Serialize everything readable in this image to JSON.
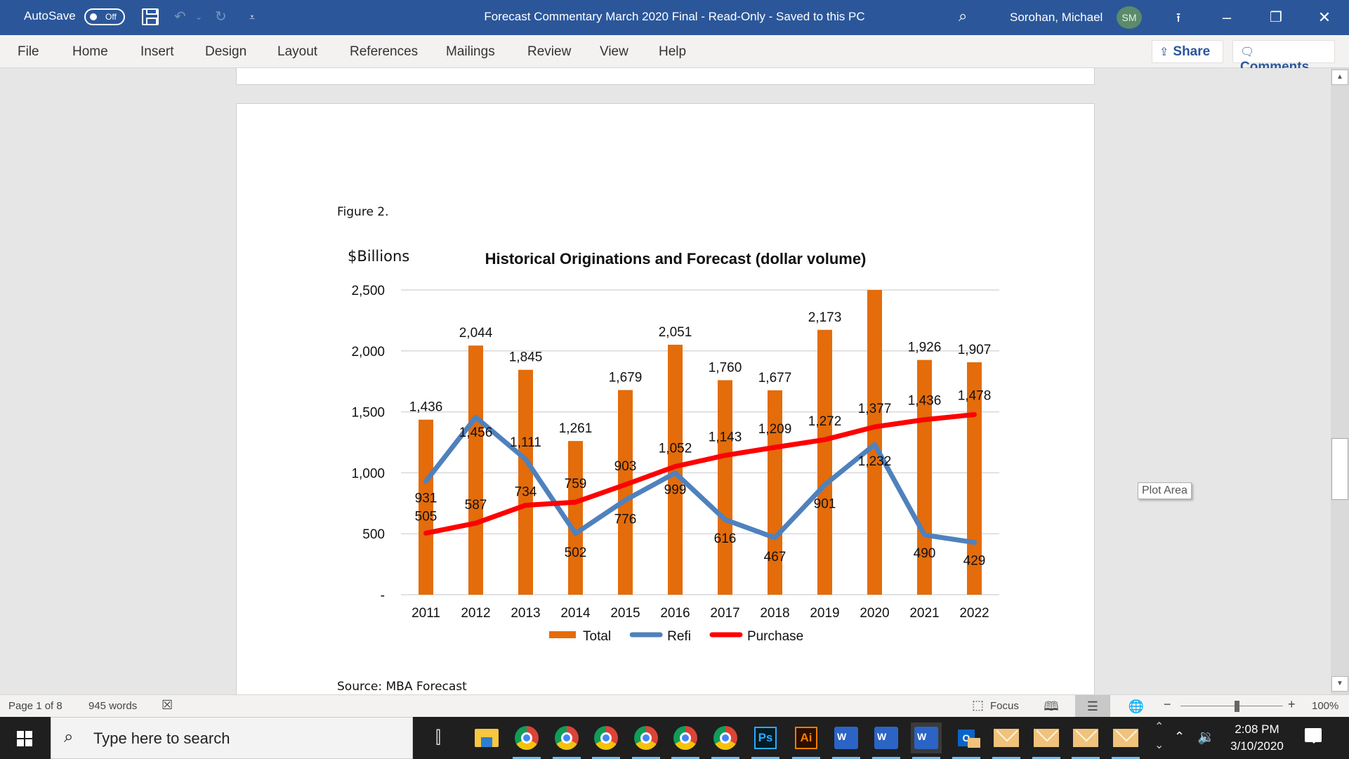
{
  "titlebar": {
    "autosave_label": "AutoSave",
    "autosave_state": "Off",
    "document_title": "Forecast Commentary March 2020 Final  -  Read-Only  -  Saved to this PC",
    "user_name": "Sorohan, Michael",
    "user_initials": "SM",
    "icons": [
      "save-icon",
      "undo-icon",
      "redo-icon",
      "customize-qat-icon",
      "search-icon",
      "ribbon-display-icon",
      "minimize-icon",
      "restore-icon",
      "close-icon"
    ]
  },
  "ribbon": {
    "tabs": [
      "File",
      "Home",
      "Insert",
      "Design",
      "Layout",
      "References",
      "Mailings",
      "Review",
      "View",
      "Help"
    ],
    "share_label": "Share",
    "comments_label": "Comments"
  },
  "document": {
    "figure_label": "Figure 2.",
    "source_label": "Source: MBA Forecast",
    "tooltip": "Plot Area"
  },
  "chart_data": {
    "type": "bar",
    "title": "Historical Originations and Forecast (dollar volume)",
    "ylabel": "$Billions",
    "xlabel": "",
    "ylim": [
      0,
      2500
    ],
    "yticks": [
      0,
      500,
      1000,
      1500,
      2000,
      2500
    ],
    "ytick_labels": [
      "-",
      "500",
      "1,000",
      "1,500",
      "2,000",
      "2,500"
    ],
    "grid": true,
    "legend_position": "bottom",
    "categories": [
      "2011",
      "2012",
      "2013",
      "2014",
      "2015",
      "2016",
      "2017",
      "2018",
      "2019",
      "2020",
      "2021",
      "2022"
    ],
    "series": [
      {
        "name": "Total",
        "kind": "bar",
        "color": "#e46c0a",
        "values": [
          1436,
          2044,
          1845,
          1261,
          1679,
          2051,
          1760,
          1677,
          2173,
          2500,
          1926,
          1907
        ],
        "labels": [
          "1,436",
          "2,044",
          "1,845",
          "1,261",
          "1,679",
          "2,051",
          "1,760",
          "1,677",
          "2,173",
          "",
          "1,926",
          "1,907"
        ],
        "note": "2020 bar exceeds axis max 2,500 (clipped, no label shown)"
      },
      {
        "name": "Refi",
        "kind": "line",
        "color": "#4f81bd",
        "values": [
          931,
          1456,
          1111,
          502,
          776,
          999,
          616,
          467,
          901,
          1232,
          490,
          429
        ],
        "labels": [
          "931",
          "1,456",
          "1,111",
          "502",
          "776",
          "999",
          "616",
          "467",
          "901",
          "1,232",
          "490",
          "429"
        ]
      },
      {
        "name": "Purchase",
        "kind": "line",
        "color": "#ff0000",
        "values": [
          505,
          587,
          734,
          759,
          903,
          1052,
          1143,
          1209,
          1272,
          1377,
          1436,
          1478
        ],
        "labels": [
          "505",
          "587",
          "734",
          "759",
          "903",
          "1,052",
          "1,143",
          "1,209",
          "1,272",
          "1,377",
          "1,436",
          "1,478"
        ]
      }
    ]
  },
  "statusbar": {
    "page": "Page 1 of 8",
    "words": "945 words",
    "focus_label": "Focus",
    "zoom_level": "100%",
    "zoom_fraction": 0.55
  },
  "taskbar": {
    "search_placeholder": "Type here to search",
    "apps": [
      "task-view",
      "file-explorer",
      "chrome",
      "chrome",
      "chrome",
      "chrome",
      "chrome",
      "chrome",
      "photoshop",
      "illustrator",
      "word",
      "word",
      "word",
      "outlook",
      "mail",
      "mail",
      "mail",
      "mail"
    ],
    "time": "2:08 PM",
    "date": "3/10/2020"
  }
}
